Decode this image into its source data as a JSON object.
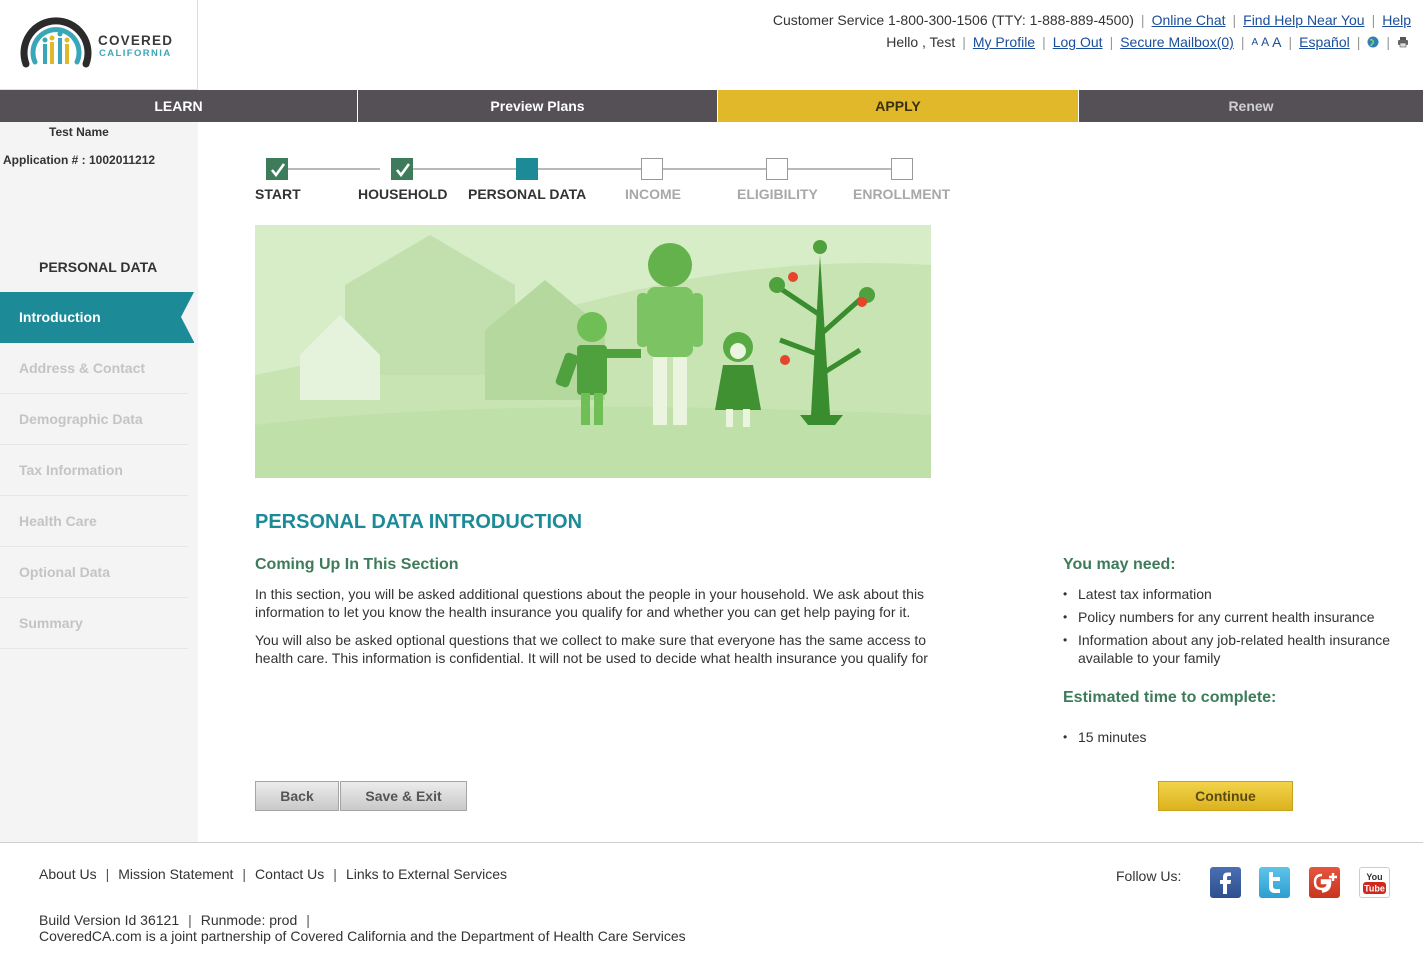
{
  "brand": {
    "name_line1": "COVERED",
    "name_line2": "CALIFORNIA",
    "colors": {
      "teal": "#1d8a98",
      "green": "#3e7b5a",
      "gold": "#e0b82a",
      "nav_gray": "#545056"
    }
  },
  "utility": {
    "customer_service": "Customer Service 1-800-300-1506 (TTY: 1-888-889-4500)",
    "online_chat": "Online Chat",
    "find_help": "Find Help Near You",
    "help": "Help",
    "greeting": "Hello , Test",
    "my_profile": "My Profile",
    "log_out": "Log Out",
    "secure_mailbox": "Secure Mailbox(0)",
    "font_small": "A",
    "font_medium": "A",
    "font_large": "A",
    "espanol": "Español",
    "globe_icon": "globe-icon",
    "print_icon": "print-icon"
  },
  "topnav": {
    "learn": "LEARN",
    "preview": "Preview Plans",
    "apply": "APPLY",
    "renew": "Renew"
  },
  "sidebar": {
    "user_name": "Test Name",
    "application_number": "Application # : 1002011212",
    "section_title": "PERSONAL DATA",
    "items": [
      {
        "label": "Introduction",
        "active": true
      },
      {
        "label": "Address & Contact",
        "active": false
      },
      {
        "label": "Demographic Data",
        "active": false
      },
      {
        "label": "Tax Information",
        "active": false
      },
      {
        "label": "Health Care",
        "active": false
      },
      {
        "label": "Optional Data",
        "active": false
      },
      {
        "label": "Summary",
        "active": false
      }
    ]
  },
  "progress": {
    "steps": [
      {
        "label": "START",
        "state": "done"
      },
      {
        "label": "HOUSEHOLD",
        "state": "done"
      },
      {
        "label": "PERSONAL DATA",
        "state": "current"
      },
      {
        "label": "INCOME",
        "state": "todo"
      },
      {
        "label": "ELIGIBILITY",
        "state": "todo"
      },
      {
        "label": "ENROLLMENT",
        "state": "todo"
      }
    ]
  },
  "main": {
    "title": "PERSONAL DATA INTRODUCTION",
    "subheading": "Coming Up In This Section",
    "paragraph1": "In this section, you will be asked additional questions about the people in your household. We ask about this information to let you know the health insurance you qualify for and whether you can get help paying for it.",
    "paragraph2": "You will also be asked optional questions that we collect to make sure that everyone has the same access to health care. This information is confidential. It will not be used to decide what health insurance you qualify for"
  },
  "aside": {
    "need_title": "You may need:",
    "need_items": [
      "Latest tax information",
      "Policy numbers for any current health insurance",
      "Information about any job-related health insurance available to your family"
    ],
    "time_title": "Estimated time to complete:",
    "time_items": [
      "15 minutes"
    ]
  },
  "buttons": {
    "back": "Back",
    "save_exit": "Save & Exit",
    "continue": "Continue"
  },
  "footer": {
    "about": "About Us",
    "mission": "Mission Statement",
    "contact": "Contact Us",
    "links_external": "Links to External Services",
    "build": "Build Version Id 36121",
    "runmode": "Runmode: prod",
    "partnership": "CoveredCA.com is a joint partnership of Covered California and the Department of Health Care Services",
    "follow": "Follow Us:",
    "social_icons": [
      "facebook-icon",
      "twitter-icon",
      "google-plus-icon",
      "youtube-icon"
    ],
    "youtube_you": "You",
    "youtube_tube": "Tube"
  }
}
